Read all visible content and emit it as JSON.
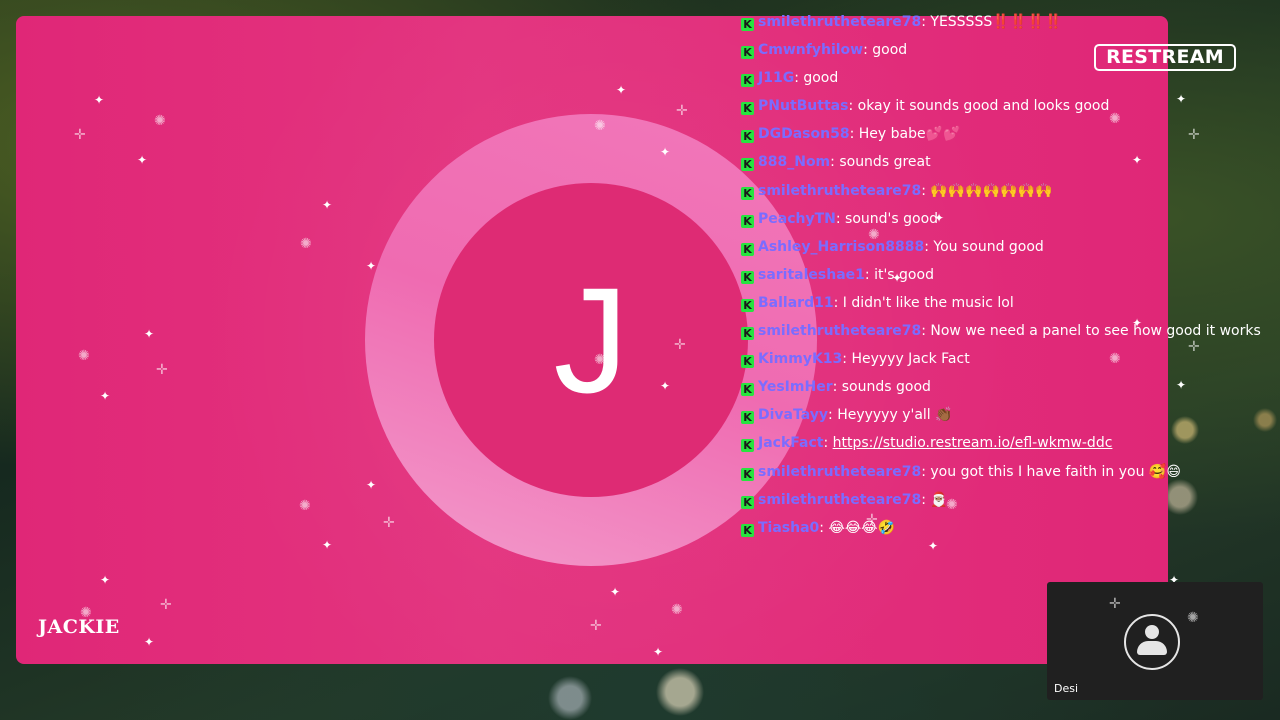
{
  "stream": {
    "brand_logo": "RESTREAM",
    "host_name": "JACKIE",
    "avatar_initial": "J"
  },
  "chat": {
    "platform_icon": "kick-icon",
    "messages": [
      {
        "user": "smilethrutheteare78",
        "text": "YESSSSS‼️‼️‼️‼️"
      },
      {
        "user": "Cmwnfyhilow",
        "text": "good"
      },
      {
        "user": "J11G",
        "text": "good"
      },
      {
        "user": "PNutButtas",
        "text": "okay it sounds good and looks good"
      },
      {
        "user": "DGDason58",
        "text": "Hey babe💕💕"
      },
      {
        "user": "888_Nom",
        "text": "sounds great"
      },
      {
        "user": "smilethrutheteare78",
        "text": "🙌🙌🙌🙌🙌🙌🙌"
      },
      {
        "user": "PeachyTN",
        "text": "sound's good"
      },
      {
        "user": "Ashley_Harrison8888",
        "text": "You sound good"
      },
      {
        "user": "saritaleshae1",
        "text": "it's good"
      },
      {
        "user": "Ballard11",
        "text": "I didn't like the music lol"
      },
      {
        "user": "smilethrutheteare78",
        "text": "Now we need a panel to see how good it works"
      },
      {
        "user": "KimmyK13",
        "text": "Heyyyy Jack Fact"
      },
      {
        "user": "YesImHer",
        "text": "sounds good"
      },
      {
        "user": "DivaTayy",
        "text": "Heyyyyy y'all 👏🏾"
      },
      {
        "user": "JackFact",
        "text": "https://studio.restream.io/efl-wkmw-ddc",
        "is_link": true
      },
      {
        "user": "smilethrutheteare78",
        "text": "you got this I have faith in you 🥰😄"
      },
      {
        "user": "smilethrutheteare78",
        "text": "🎅🏽"
      },
      {
        "user": "Tiasha0",
        "text": "😂😂😂🤣"
      }
    ]
  },
  "guest": {
    "name": "Desi",
    "avatar_icon": "user-avatar-icon"
  },
  "colors": {
    "stage_bg": "#e02777",
    "ring": "#f278ba",
    "disc": "#de2b74",
    "username": "#7b6cff",
    "platform_icon": "#27e33f"
  }
}
